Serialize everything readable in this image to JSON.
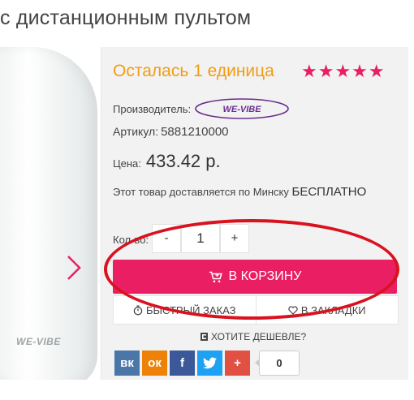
{
  "page": {
    "title": "с дистанционным пультом"
  },
  "product": {
    "stock_text": "Осталась 1 единица",
    "stars": "★★★★★",
    "manufacturer_label": "Производитель:",
    "manufacturer_logo_text": "WE-VIBE",
    "sku_label": "Артикул:",
    "sku_value": "5881210000",
    "price_label": "Цена:",
    "price_value": "433.42 р.",
    "delivery_text": "Этот товар доставляется по Минску",
    "delivery_free": "БЕСПЛАТНО",
    "image_logo_text": "WE-VIBE"
  },
  "quantity": {
    "label": "Кол-во:",
    "minus": "-",
    "value": "1",
    "plus": "+"
  },
  "actions": {
    "cart_label": "В КОРЗИНУ",
    "quick_order_label": "БЫСТРЫЙ ЗАКАЗ",
    "bookmarks_label": "В ЗАКЛАДКИ",
    "cheaper_label": "ХОТИТЕ ДЕШЕВЛЕ?"
  },
  "share": {
    "vk": "вк",
    "ok": "ок",
    "fb": "f",
    "plus": "+",
    "count": "0"
  },
  "colors": {
    "accent": "#e91e63",
    "stock": "#f39c12",
    "annotation": "#d9121f",
    "brand_logo": "#6a2c8f"
  }
}
